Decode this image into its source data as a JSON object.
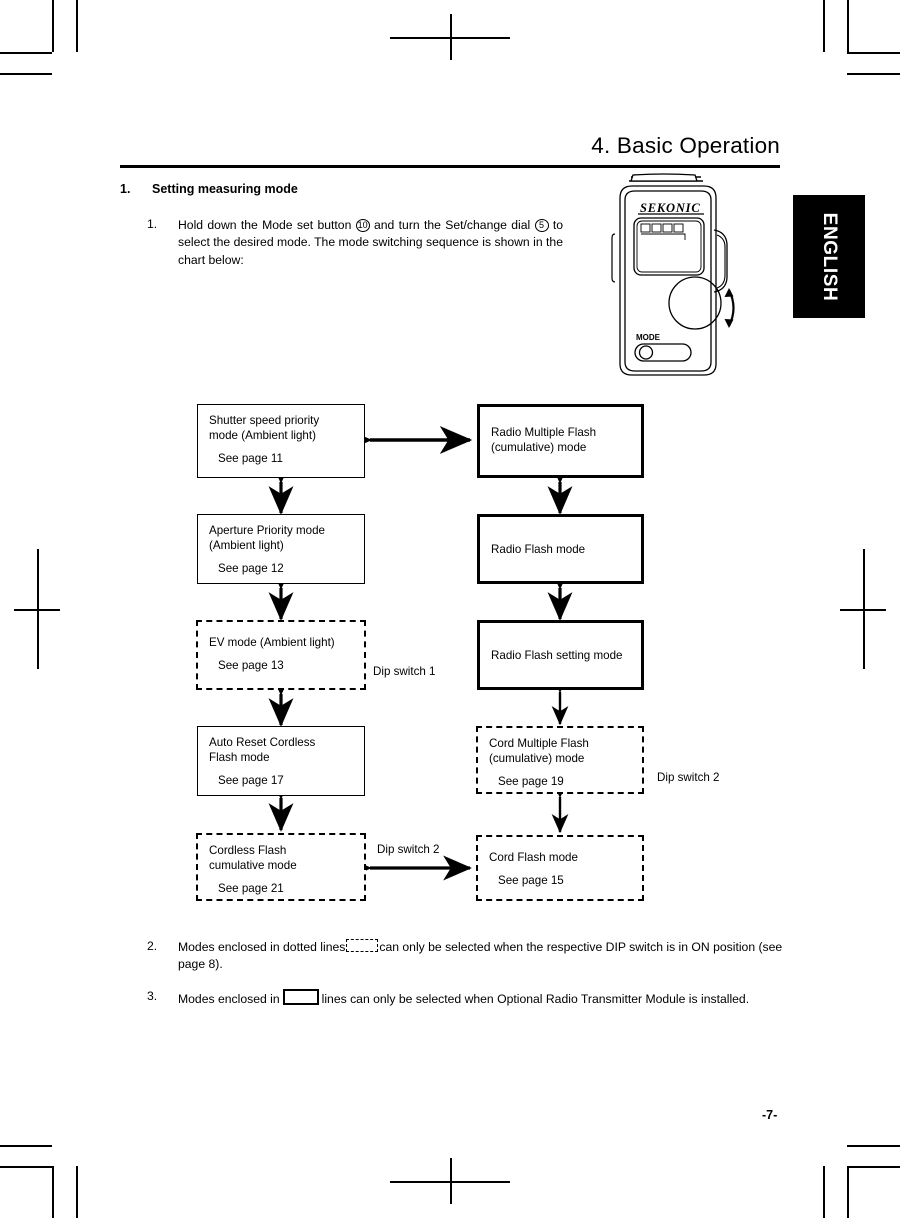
{
  "page": {
    "title": "4.  Basic Operation",
    "number": "-7-",
    "side_tab": "ENGLISH"
  },
  "section": {
    "number": "1.",
    "title": "Setting measuring mode"
  },
  "steps": [
    {
      "number": "1.",
      "text_part1": "Hold down the Mode set button ",
      "circled1": "10",
      "text_part2": " and turn the Set/change dial ",
      "circled2": "5",
      "text_part3": " to select the desired mode. The mode switching sequence is shown in the chart below:"
    },
    {
      "number": "2.",
      "text_part1": "Modes enclosed in dotted lines",
      "text_part2": "can only be selected when the respective DIP switch is in ON position (see page 8)."
    },
    {
      "number": "3.",
      "text_part1": "Modes enclosed in",
      "text_part2": "lines can only be selected when Optional Radio Transmitter Module is installed."
    }
  ],
  "device": {
    "brand": "SEKONIC",
    "mode_button_label": "MODE"
  },
  "flowchart": {
    "left_column": [
      {
        "id": "shutter-speed-priority",
        "label_line1": "Shutter speed priority",
        "label_line2": "mode (Ambient light)",
        "page_ref": "See page 11",
        "border": "solid"
      },
      {
        "id": "aperture-priority",
        "label_line1": "Aperture Priority mode",
        "label_line2": "(Ambient light)",
        "page_ref": "See page 12",
        "border": "solid"
      },
      {
        "id": "ev-mode",
        "label_line1": "EV mode (Ambient light)",
        "label_line2": "",
        "page_ref": "See page 13",
        "border": "dashed"
      },
      {
        "id": "auto-reset-cordless",
        "label_line1": "Auto Reset Cordless",
        "label_line2": "Flash mode",
        "page_ref": "See page 17",
        "border": "solid"
      },
      {
        "id": "cordless-flash-cumulative",
        "label_line1": "Cordless Flash",
        "label_line2": "cumulative mode",
        "page_ref": "See page 21",
        "border": "dashed"
      }
    ],
    "right_column": [
      {
        "id": "radio-multiple-flash",
        "label_line1": "Radio Multiple Flash",
        "label_line2": "(cumulative) mode",
        "page_ref": "",
        "border": "thick"
      },
      {
        "id": "radio-flash",
        "label_line1": "Radio Flash mode",
        "label_line2": "",
        "page_ref": "",
        "border": "thick"
      },
      {
        "id": "radio-flash-setting",
        "label_line1": "Radio Flash setting mode",
        "label_line2": "",
        "page_ref": "",
        "border": "thick"
      },
      {
        "id": "cord-multiple-flash",
        "label_line1": "Cord Multiple Flash",
        "label_line2": "(cumulative) mode",
        "page_ref": "See page 19",
        "border": "dashed"
      },
      {
        "id": "cord-flash",
        "label_line1": "Cord Flash mode",
        "label_line2": "",
        "page_ref": "See page 15",
        "border": "dashed"
      }
    ],
    "switch_labels": {
      "dip1": "Dip switch 1",
      "dip2_right": "Dip switch 2",
      "dip2_bottom": "Dip switch 2"
    }
  }
}
